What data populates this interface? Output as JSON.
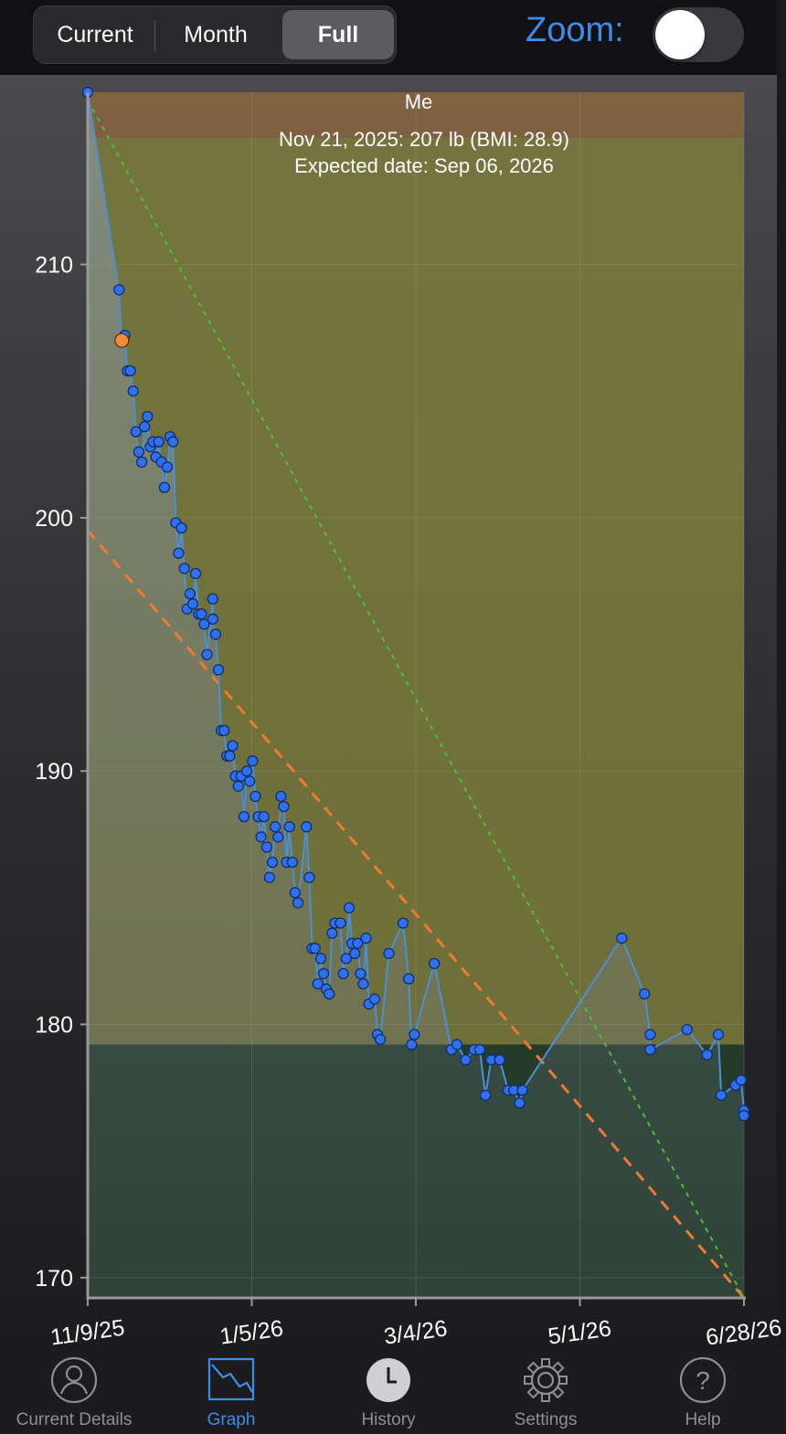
{
  "header": {
    "segments": [
      {
        "label": "Current",
        "active": false
      },
      {
        "label": "Month",
        "active": false
      },
      {
        "label": "Full",
        "active": true
      }
    ],
    "zoom_label": "Zoom:",
    "zoom_on": false
  },
  "chart_data": {
    "type": "line",
    "title": "Me",
    "annotation_line1": "Nov 21, 2025: 207 lb (BMI: 28.9)",
    "annotation_line2": "Expected date: Sep 06, 2026",
    "xlabel": "",
    "ylabel": "",
    "ylim": [
      169.2,
      216.8
    ],
    "xlim": [
      "2025-11-09",
      "2026-06-28"
    ],
    "x_ticks": [
      "11/9/25",
      "1/5/26",
      "3/4/26",
      "5/1/26",
      "6/28/26"
    ],
    "y_ticks": [
      170,
      180,
      190,
      200,
      210
    ],
    "grid": true,
    "bands": [
      {
        "from": 215,
        "to": 216.8,
        "color": "#8a6640"
      },
      {
        "from": 179.2,
        "to": 215,
        "color": "#7c7c3c"
      },
      {
        "from": 169.2,
        "to": 179.2,
        "color": "#26402a"
      }
    ],
    "highlight": {
      "date": "2025-11-21",
      "value": 207,
      "color": "#f08c3c"
    },
    "trend_lines": [
      {
        "style": "dashed-orange",
        "color": "#f07a32",
        "start": {
          "date": "2025-11-09",
          "value": 199.5
        },
        "end": {
          "date": "2026-06-28",
          "value": 169.2
        }
      },
      {
        "style": "dotted-green",
        "color": "#4ec034",
        "start": {
          "date": "2025-11-09",
          "value": 216.5
        },
        "end": {
          "date": "2026-06-28",
          "value": 169.2
        }
      }
    ],
    "series": [
      {
        "color": "#2f6ff0",
        "line_color": "#4a8fd8",
        "points": [
          [
            "2025-11-09",
            216.8
          ],
          [
            "2025-11-20",
            209.0
          ],
          [
            "2025-11-21",
            207.0
          ],
          [
            "2025-11-22",
            207.2
          ],
          [
            "2025-11-23",
            205.8
          ],
          [
            "2025-11-24",
            205.8
          ],
          [
            "2025-11-25",
            205.0
          ],
          [
            "2025-11-26",
            203.4
          ],
          [
            "2025-11-27",
            202.6
          ],
          [
            "2025-11-28",
            202.2
          ],
          [
            "2025-11-29",
            203.6
          ],
          [
            "2025-11-30",
            204.0
          ],
          [
            "2025-12-01",
            202.8
          ],
          [
            "2025-12-02",
            203.0
          ],
          [
            "2025-12-03",
            202.4
          ],
          [
            "2025-12-04",
            203.0
          ],
          [
            "2025-12-05",
            202.2
          ],
          [
            "2025-12-06",
            201.2
          ],
          [
            "2025-12-07",
            202.0
          ],
          [
            "2025-12-08",
            203.2
          ],
          [
            "2025-12-09",
            203.0
          ],
          [
            "2025-12-10",
            199.8
          ],
          [
            "2025-12-11",
            198.6
          ],
          [
            "2025-12-12",
            199.6
          ],
          [
            "2025-12-13",
            198.0
          ],
          [
            "2025-12-14",
            196.4
          ],
          [
            "2025-12-15",
            197.0
          ],
          [
            "2025-12-16",
            196.6
          ],
          [
            "2025-12-17",
            197.8
          ],
          [
            "2025-12-18",
            196.2
          ],
          [
            "2025-12-19",
            196.2
          ],
          [
            "2025-12-20",
            195.8
          ],
          [
            "2025-12-21",
            194.6
          ],
          [
            "2025-12-23",
            196.8
          ],
          [
            "2025-12-23",
            196.0
          ],
          [
            "2025-12-24",
            195.4
          ],
          [
            "2025-12-25",
            194.0
          ],
          [
            "2025-12-26",
            191.6
          ],
          [
            "2025-12-27",
            191.6
          ],
          [
            "2025-12-28",
            190.6
          ],
          [
            "2025-12-29",
            190.6
          ],
          [
            "2025-12-30",
            191.0
          ],
          [
            "2025-12-31",
            189.8
          ],
          [
            "2026-01-01",
            189.4
          ],
          [
            "2026-01-02",
            189.8
          ],
          [
            "2026-01-03",
            188.2
          ],
          [
            "2026-01-04",
            190.0
          ],
          [
            "2026-01-05",
            189.6
          ],
          [
            "2026-01-06",
            190.4
          ],
          [
            "2026-01-07",
            189.0
          ],
          [
            "2026-01-08",
            188.2
          ],
          [
            "2026-01-09",
            187.4
          ],
          [
            "2026-01-10",
            188.2
          ],
          [
            "2026-01-11",
            187.0
          ],
          [
            "2026-01-12",
            185.8
          ],
          [
            "2026-01-13",
            186.4
          ],
          [
            "2026-01-14",
            187.8
          ],
          [
            "2026-01-15",
            187.4
          ],
          [
            "2026-01-16",
            189.0
          ],
          [
            "2026-01-17",
            188.6
          ],
          [
            "2026-01-18",
            186.4
          ],
          [
            "2026-01-19",
            187.8
          ],
          [
            "2026-01-20",
            186.4
          ],
          [
            "2026-01-21",
            185.2
          ],
          [
            "2026-01-22",
            184.8
          ],
          [
            "2026-01-25",
            187.8
          ],
          [
            "2026-01-26",
            185.8
          ],
          [
            "2026-01-27",
            183.0
          ],
          [
            "2026-01-28",
            183.0
          ],
          [
            "2026-01-29",
            181.6
          ],
          [
            "2026-01-30",
            182.6
          ],
          [
            "2026-01-31",
            182.0
          ],
          [
            "2026-02-01",
            181.4
          ],
          [
            "2026-02-02",
            181.2
          ],
          [
            "2026-02-03",
            183.6
          ],
          [
            "2026-02-04",
            184.0
          ],
          [
            "2026-02-06",
            184.0
          ],
          [
            "2026-02-07",
            182.0
          ],
          [
            "2026-02-08",
            182.6
          ],
          [
            "2026-02-09",
            184.6
          ],
          [
            "2026-02-10",
            183.2
          ],
          [
            "2026-02-11",
            182.8
          ],
          [
            "2026-02-12",
            183.2
          ],
          [
            "2026-02-13",
            182.0
          ],
          [
            "2026-02-14",
            181.6
          ],
          [
            "2026-02-15",
            183.4
          ],
          [
            "2026-02-16",
            180.8
          ],
          [
            "2026-02-18",
            181.0
          ],
          [
            "2026-02-19",
            179.6
          ],
          [
            "2026-02-20",
            179.4
          ],
          [
            "2026-02-23",
            182.8
          ],
          [
            "2026-02-28",
            184.0
          ],
          [
            "2026-03-02",
            181.8
          ],
          [
            "2026-03-03",
            179.2
          ],
          [
            "2026-03-04",
            179.6
          ],
          [
            "2026-03-11",
            182.4
          ],
          [
            "2026-03-17",
            179.0
          ],
          [
            "2026-03-19",
            179.2
          ],
          [
            "2026-03-22",
            178.6
          ],
          [
            "2026-03-25",
            179.0
          ],
          [
            "2026-03-27",
            179.0
          ],
          [
            "2026-03-29",
            177.2
          ],
          [
            "2026-03-31",
            178.6
          ],
          [
            "2026-04-03",
            178.6
          ],
          [
            "2026-04-06",
            177.4
          ],
          [
            "2026-04-08",
            177.4
          ],
          [
            "2026-04-10",
            176.9
          ],
          [
            "2026-04-11",
            177.4
          ],
          [
            "2026-05-16",
            183.4
          ],
          [
            "2026-05-24",
            181.2
          ],
          [
            "2026-05-26",
            179.6
          ],
          [
            "2026-05-26",
            179.0
          ],
          [
            "2026-06-08",
            179.8
          ],
          [
            "2026-06-15",
            178.8
          ],
          [
            "2026-06-19",
            179.6
          ],
          [
            "2026-06-20",
            177.2
          ],
          [
            "2026-06-25",
            177.6
          ],
          [
            "2026-06-27",
            177.8
          ],
          [
            "2026-06-28",
            176.6
          ],
          [
            "2026-06-28",
            176.4
          ]
        ]
      }
    ]
  },
  "tabs": [
    {
      "label": "Current Details",
      "icon": "person-icon",
      "active": false
    },
    {
      "label": "Graph",
      "icon": "graph-icon",
      "active": true
    },
    {
      "label": "History",
      "icon": "clock-icon",
      "active": false
    },
    {
      "label": "Settings",
      "icon": "gear-icon",
      "active": false
    },
    {
      "label": "Help",
      "icon": "help-icon",
      "active": false
    }
  ]
}
